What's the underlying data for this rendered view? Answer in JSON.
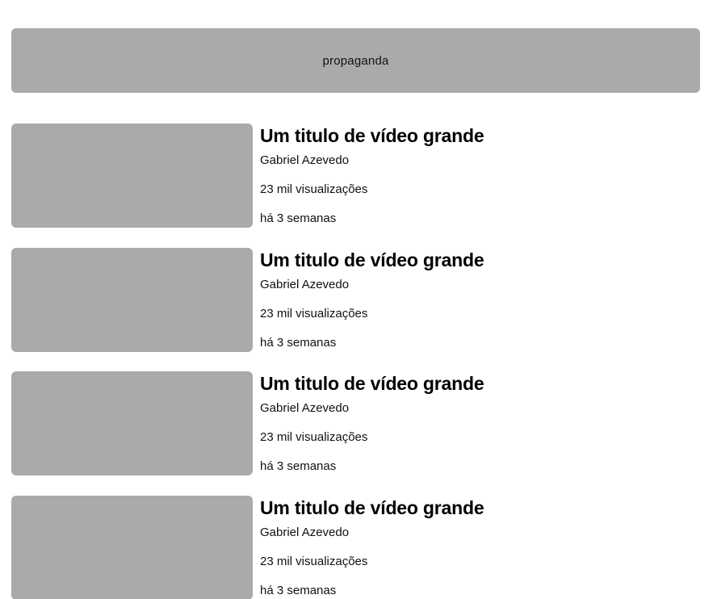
{
  "ad": {
    "label": "propaganda"
  },
  "videos": [
    {
      "title": "Um titulo de vídeo grande",
      "channel": "Gabriel Azevedo",
      "views": "23 mil visualizações",
      "age": "há 3 semanas"
    },
    {
      "title": "Um titulo de vídeo grande",
      "channel": "Gabriel Azevedo",
      "views": "23 mil visualizações",
      "age": "há 3 semanas"
    },
    {
      "title": "Um titulo de vídeo grande",
      "channel": "Gabriel Azevedo",
      "views": "23 mil visualizações",
      "age": "há 3 semanas"
    },
    {
      "title": "Um titulo de vídeo grande",
      "channel": "Gabriel Azevedo",
      "views": "23 mil visualizações",
      "age": "há 3 semanas"
    }
  ],
  "colors": {
    "placeholder": "#aaaaaa",
    "text": "#000000",
    "background": "#ffffff"
  }
}
